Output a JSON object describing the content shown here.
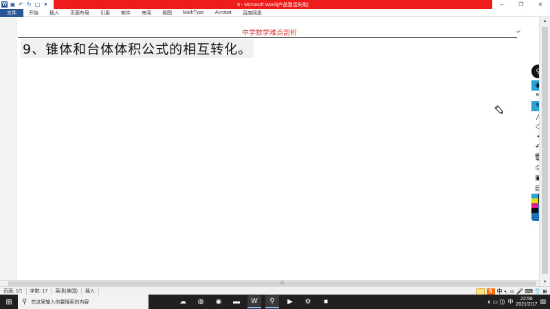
{
  "app": {
    "title": "8 - Microsoft Word(产品激活失败)"
  },
  "window_controls": {
    "minimize": "–",
    "restore": "❐",
    "close": "✕"
  },
  "quick_access": {
    "word_logo": "W",
    "save_icon": "save-icon",
    "undo_icon": "undo-icon",
    "redo_icon": "redo-icon",
    "customize_icon": "customize-icon"
  },
  "ribbon": {
    "tabs": [
      "文件",
      "开始",
      "插入",
      "页面布局",
      "引用",
      "邮件",
      "审阅",
      "视图",
      "MathType",
      "Acrobat",
      "百度网盘"
    ]
  },
  "document": {
    "header_text": "中学数学难点剖析",
    "header_mark": "↵",
    "heading": "9、锥体和台体体积公式的相互转化。"
  },
  "annotation_toolbar": {
    "pin_glyph": "⚲",
    "tools": [
      {
        "icon": "eye-icon",
        "glyph": "◉",
        "active": true
      },
      {
        "icon": "pointer-icon",
        "glyph": "↖",
        "active": false
      },
      {
        "icon": "pen-icon",
        "glyph": "✎",
        "active": true
      },
      {
        "icon": "line-icon",
        "glyph": "╱",
        "active": false
      },
      {
        "icon": "eraser-icon",
        "glyph": "◇",
        "active": false
      },
      {
        "icon": "dot-icon",
        "glyph": "•",
        "active": false
      },
      {
        "icon": "undo-icon",
        "glyph": "↶",
        "active": false
      },
      {
        "icon": "trash-icon",
        "glyph": "🗑",
        "active": false
      },
      {
        "icon": "print-icon",
        "glyph": "⎙",
        "active": false
      },
      {
        "icon": "camera-icon",
        "glyph": "▣",
        "active": false
      },
      {
        "icon": "clipboard-icon",
        "glyph": "▤",
        "active": false
      }
    ],
    "palette": [
      "#2aa3d8",
      "#111111",
      "#e0e000",
      "#111111",
      "#e0198a",
      "#1e6fb8",
      "#111111",
      "#1e6fb8"
    ]
  },
  "statusbar": {
    "page": "页面: 1/1",
    "words": "字数: 17",
    "language": "英语(美国)",
    "mode": "插入"
  },
  "ime": {
    "logo": "S",
    "lang": "中",
    "symbols": "•, ☺ 🎤 ⌨ 👕 ⊞"
  },
  "taskbar": {
    "start_glyph": "⊞",
    "search_placeholder": "在这里输入你要搜索的内容",
    "apps": [
      {
        "name": "app-cloud",
        "glyph": "☁",
        "active": false
      },
      {
        "name": "app-wechat",
        "glyph": "◍",
        "active": false
      },
      {
        "name": "app-browser",
        "glyph": "◉",
        "active": false
      },
      {
        "name": "app-folder",
        "glyph": "▬",
        "active": false
      },
      {
        "name": "app-word",
        "glyph": "W",
        "active": true
      },
      {
        "name": "app-maps",
        "glyph": "⚲",
        "active": true
      },
      {
        "name": "app-player",
        "glyph": "▶",
        "active": false
      },
      {
        "name": "app-settings",
        "glyph": "⚙",
        "active": false
      },
      {
        "name": "app-recorder",
        "glyph": "■",
        "active": false
      }
    ],
    "tray_icons": "∧  ▭  ))) ",
    "ime": "中",
    "time": "22:56",
    "date": "2021/2/17",
    "notification": "▤"
  },
  "colors": {
    "title_red": "#ef1c1c",
    "word_blue": "#2b579a",
    "tool_active": "#2aa3d8"
  }
}
